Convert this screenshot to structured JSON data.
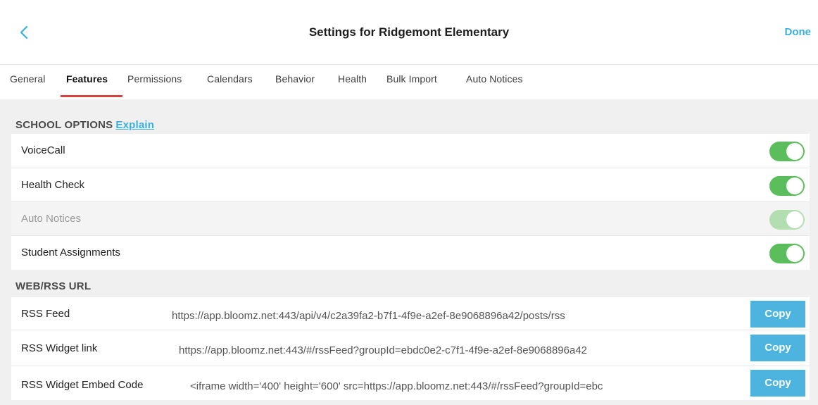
{
  "header": {
    "title": "Settings for Ridgemont Elementary",
    "done_label": "Done"
  },
  "tabs": [
    {
      "label": "General"
    },
    {
      "label": "Features",
      "active": true
    },
    {
      "label": "Permissions"
    },
    {
      "label": "Calendars"
    },
    {
      "label": "Behavior"
    },
    {
      "label": "Health"
    },
    {
      "label": "Bulk Import"
    },
    {
      "label": "Auto Notices"
    }
  ],
  "school_options": {
    "heading": "SCHOOL OPTIONS",
    "explain_label": "Explain",
    "items": [
      {
        "label": "VoiceCall",
        "enabled": true,
        "disabled": false
      },
      {
        "label": "Health Check",
        "enabled": true,
        "disabled": false
      },
      {
        "label": "Auto Notices",
        "enabled": true,
        "disabled": true
      },
      {
        "label": "Student Assignments",
        "enabled": true,
        "disabled": false
      }
    ]
  },
  "web_rss": {
    "heading": "WEB/RSS URL",
    "copy_label": "Copy",
    "items": [
      {
        "label": "RSS Feed",
        "value": "https://app.bloomz.net:443/api/v4/c2a39fa2-b7f1-4f9e-a2ef-8e9068896a42/posts/rss"
      },
      {
        "label": "RSS Widget link",
        "value": "https://app.bloomz.net:443/#/rssFeed?groupId=ebdc0e2-c7f1-4f9e-a2ef-8e9068896a42"
      },
      {
        "label": "RSS Widget Embed Code",
        "value": "<iframe width='400' height='600' src=https://app.bloomz.net:443/#/rssFeed?groupId=ebc"
      }
    ]
  },
  "colors": {
    "accent": "#3ab0dc",
    "toggle_on": "#5cbd5c",
    "tab_underline": "#d94141",
    "copy_button": "#4cb4de"
  }
}
